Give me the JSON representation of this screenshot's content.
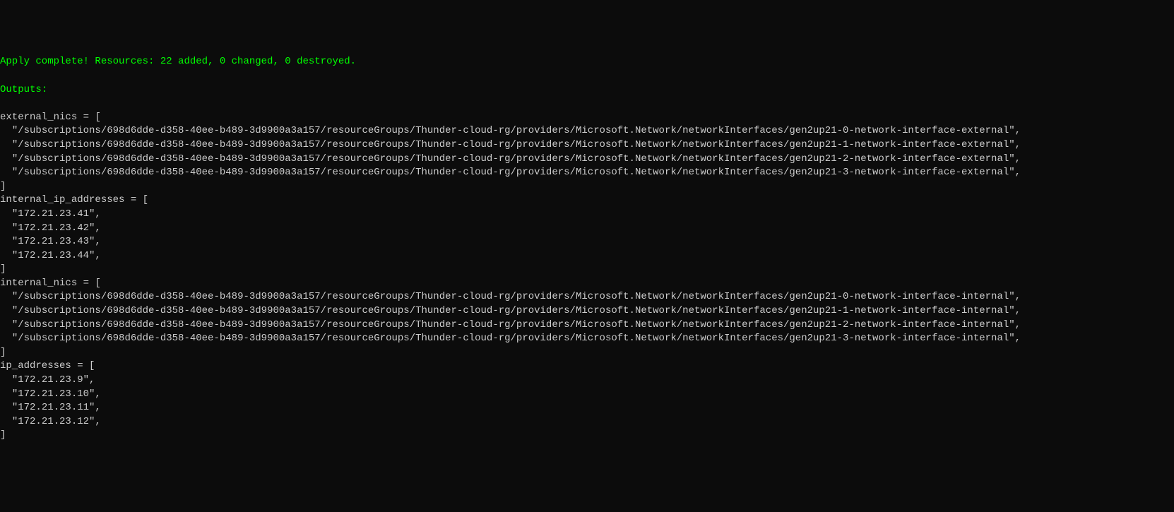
{
  "status_line": "Apply complete! Resources: 22 added, 0 changed, 0 destroyed.",
  "outputs_header": "Outputs:",
  "outputs": {
    "external_nics": {
      "label": "external_nics = [",
      "items": [
        "\"/subscriptions/698d6dde-d358-40ee-b489-3d9900a3a157/resourceGroups/Thunder-cloud-rg/providers/Microsoft.Network/networkInterfaces/gen2up21-0-network-interface-external\",",
        "\"/subscriptions/698d6dde-d358-40ee-b489-3d9900a3a157/resourceGroups/Thunder-cloud-rg/providers/Microsoft.Network/networkInterfaces/gen2up21-1-network-interface-external\",",
        "\"/subscriptions/698d6dde-d358-40ee-b489-3d9900a3a157/resourceGroups/Thunder-cloud-rg/providers/Microsoft.Network/networkInterfaces/gen2up21-2-network-interface-external\",",
        "\"/subscriptions/698d6dde-d358-40ee-b489-3d9900a3a157/resourceGroups/Thunder-cloud-rg/providers/Microsoft.Network/networkInterfaces/gen2up21-3-network-interface-external\","
      ],
      "close": "]"
    },
    "internal_ip_addresses": {
      "label": "internal_ip_addresses = [",
      "items": [
        "\"172.21.23.41\",",
        "\"172.21.23.42\",",
        "\"172.21.23.43\",",
        "\"172.21.23.44\","
      ],
      "close": "]"
    },
    "internal_nics": {
      "label": "internal_nics = [",
      "items": [
        "\"/subscriptions/698d6dde-d358-40ee-b489-3d9900a3a157/resourceGroups/Thunder-cloud-rg/providers/Microsoft.Network/networkInterfaces/gen2up21-0-network-interface-internal\",",
        "\"/subscriptions/698d6dde-d358-40ee-b489-3d9900a3a157/resourceGroups/Thunder-cloud-rg/providers/Microsoft.Network/networkInterfaces/gen2up21-1-network-interface-internal\",",
        "\"/subscriptions/698d6dde-d358-40ee-b489-3d9900a3a157/resourceGroups/Thunder-cloud-rg/providers/Microsoft.Network/networkInterfaces/gen2up21-2-network-interface-internal\",",
        "\"/subscriptions/698d6dde-d358-40ee-b489-3d9900a3a157/resourceGroups/Thunder-cloud-rg/providers/Microsoft.Network/networkInterfaces/gen2up21-3-network-interface-internal\","
      ],
      "close": "]"
    },
    "ip_addresses": {
      "label": "ip_addresses = [",
      "items": [
        "\"172.21.23.9\",",
        "\"172.21.23.10\",",
        "\"172.21.23.11\",",
        "\"172.21.23.12\","
      ],
      "close": "]"
    }
  }
}
